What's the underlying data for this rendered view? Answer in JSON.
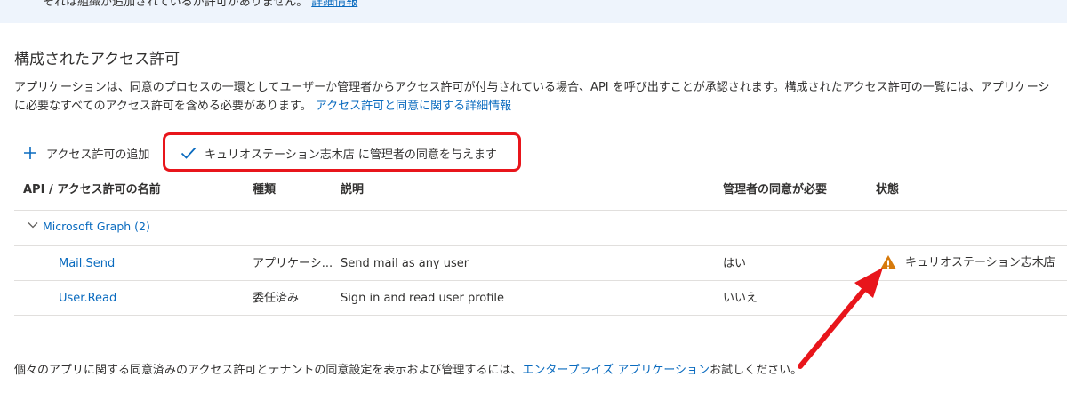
{
  "banner": {
    "text": "それは組織が追加されているが許可がありません。",
    "link": "詳細情報"
  },
  "section": {
    "title": "構成されたアクセス許可",
    "description_line1": "アプリケーションは、同意のプロセスの一環としてユーザーか管理者からアクセス許可が付与されている場合、API を呼び出すことが承認されます。構成されたアクセス許可の一覧には、アプリケーシ",
    "description_line2": "に必要なすべてのアクセス許可を含める必要があります。",
    "description_link": "アクセス許可と同意に関する詳細情報"
  },
  "toolbar": {
    "add_label": "アクセス許可の追加",
    "consent_label": "キュリオステーション志木店 に管理者の同意を与えます"
  },
  "table": {
    "columns": [
      "API / アクセス許可の名前",
      "種類",
      "説明",
      "管理者の同意が必要",
      "状態"
    ],
    "group": "Microsoft Graph (2)",
    "rows": [
      {
        "name": "Mail.Send",
        "type": "アプリケーシ...",
        "description": "Send mail as any user",
        "admin_consent": "はい",
        "status": "キュリオステーション志木店",
        "status_more": "..."
      },
      {
        "name": "User.Read",
        "type": "委任済み",
        "description": "Sign in and read user profile",
        "admin_consent": "いいえ",
        "status": "",
        "status_more": ""
      }
    ]
  },
  "footer": {
    "text_before": "個々のアプリに関する同意済みのアクセス許可とテナントの同意設定を表示および管理するには、",
    "link": "エンタープライズ アプリケーション",
    "text_after": "お試しください。"
  },
  "icons": {
    "add": "plus-icon",
    "consent": "checkmark-icon",
    "group_toggle": "chevron-down-icon",
    "warning": "warning-icon"
  },
  "colors": {
    "link": "#0a6bbf",
    "warning": "#d67a0c",
    "highlight": "#e8151b",
    "banner_bg": "#eef4fc"
  }
}
